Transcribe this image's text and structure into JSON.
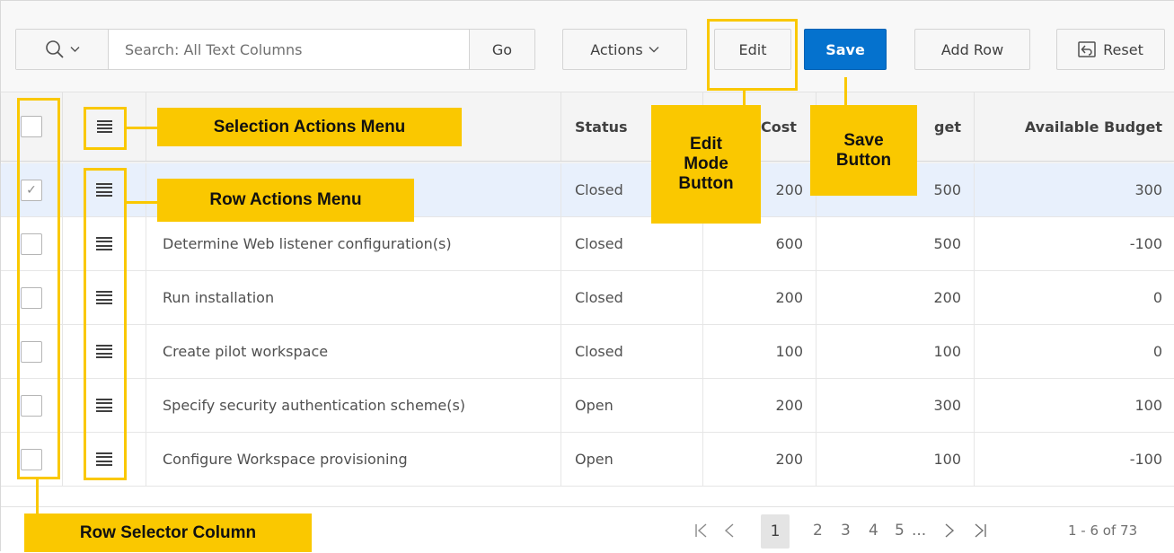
{
  "toolbar": {
    "search_placeholder": "Search: All Text Columns",
    "go_label": "Go",
    "actions_label": "Actions",
    "edit_label": "Edit",
    "save_label": "Save",
    "add_row_label": "Add Row",
    "reset_label": "Reset"
  },
  "grid": {
    "columns": {
      "status": "Status",
      "cost": "Cost",
      "budget": "get",
      "available_budget": "Available Budget"
    },
    "rows": [
      {
        "task": "",
        "status": "Closed",
        "cost": "200",
        "budget": "500",
        "available": "300",
        "selected": true
      },
      {
        "task": "Determine Web listener configuration(s)",
        "status": "Closed",
        "cost": "600",
        "budget": "500",
        "available": "-100",
        "selected": false
      },
      {
        "task": "Run installation",
        "status": "Closed",
        "cost": "200",
        "budget": "200",
        "available": "0",
        "selected": false
      },
      {
        "task": "Create pilot workspace",
        "status": "Closed",
        "cost": "100",
        "budget": "100",
        "available": "0",
        "selected": false
      },
      {
        "task": "Specify security authentication scheme(s)",
        "status": "Open",
        "cost": "200",
        "budget": "300",
        "available": "100",
        "selected": false
      },
      {
        "task": "Configure Workspace provisioning",
        "status": "Open",
        "cost": "200",
        "budget": "100",
        "available": "-100",
        "selected": false
      }
    ]
  },
  "pagination": {
    "first": "|<",
    "prev": "<",
    "pages": [
      "1",
      "2",
      "3",
      "4",
      "5"
    ],
    "ellipsis": "...",
    "next": ">",
    "last": ">|",
    "range": "1 - 6 of 73",
    "current_page": "1"
  },
  "annotations": {
    "selection_actions_menu": "Selection Actions Menu",
    "row_actions_menu": "Row Actions Menu",
    "edit_mode_button": [
      "Edit",
      "Mode",
      "Button"
    ],
    "save_button": [
      "Save",
      "Button"
    ],
    "row_selector_column": "Row Selector Column"
  },
  "colors": {
    "accent": "#0572ce",
    "annotation": "#fac800",
    "selected_row": "#e8f0fc"
  }
}
